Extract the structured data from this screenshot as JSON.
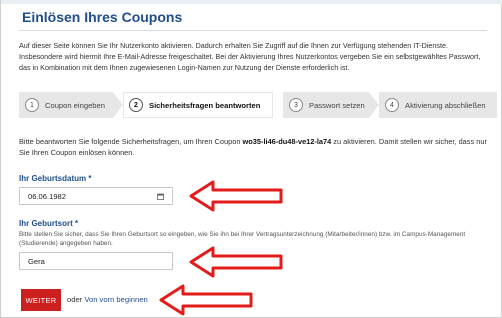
{
  "page": {
    "title": "Einlösen Ihres Coupons",
    "intro": "Auf dieser Seite können Sie Ihr Nutzerkonto aktivieren. Dadurch erhalten Sie Zugriff auf die Ihnen zur Verfügung stehenden IT-Dienste. Insbesondere wird hiermit Ihre E-Mail-Adresse freigeschaltet. Bei der Aktivierung Ihres Nutzerkontos vergeben Sie ein selbstgewähltes Passwort, das in Kombination mit dem Ihnen zugewiesenen Login-Namen zur Nutzung der Dienste erforderlich ist."
  },
  "steps": [
    {
      "num": "1",
      "label": "Coupon eingeben",
      "active": false
    },
    {
      "num": "2",
      "label": "Sicherheitsfragen beantworten",
      "active": true
    },
    {
      "num": "3",
      "label": "Passwort setzen",
      "active": false
    },
    {
      "num": "4",
      "label": "Aktivierung abschließen",
      "active": false
    }
  ],
  "description": {
    "before": "Bitte beantworten Sie folgende Sicherheitsfragen, um Ihren Coupon ",
    "coupon": "wo35-li46-du48-ve12-la74",
    "after": " zu aktivieren. Damit stellen wir sicher, dass nur Sie Ihren Coupon einlösen können."
  },
  "form": {
    "birthdate_label": "Ihr Geburtsdatum *",
    "birthdate_value": "06.06.1982",
    "birthplace_label": "Ihr Geburtsort *",
    "birthplace_hint": "Bitte stellen Sie sicher, dass Sie Ihren Geburtsort so eingeben, wie Sie ihn bei Ihrer Vertragsunterzeichnung (Mitarbeiter/innen) bzw. im Campus-Management (Studierende) angegeben haben.",
    "birthplace_value": "Gera"
  },
  "actions": {
    "next_label": "WEITER",
    "or_text": "oder",
    "restart_label": "Von vorn beginnen"
  },
  "colors": {
    "accent": "#1f4e8c",
    "button": "#cc1f1f",
    "annotation_arrow": "#e31b1b"
  }
}
